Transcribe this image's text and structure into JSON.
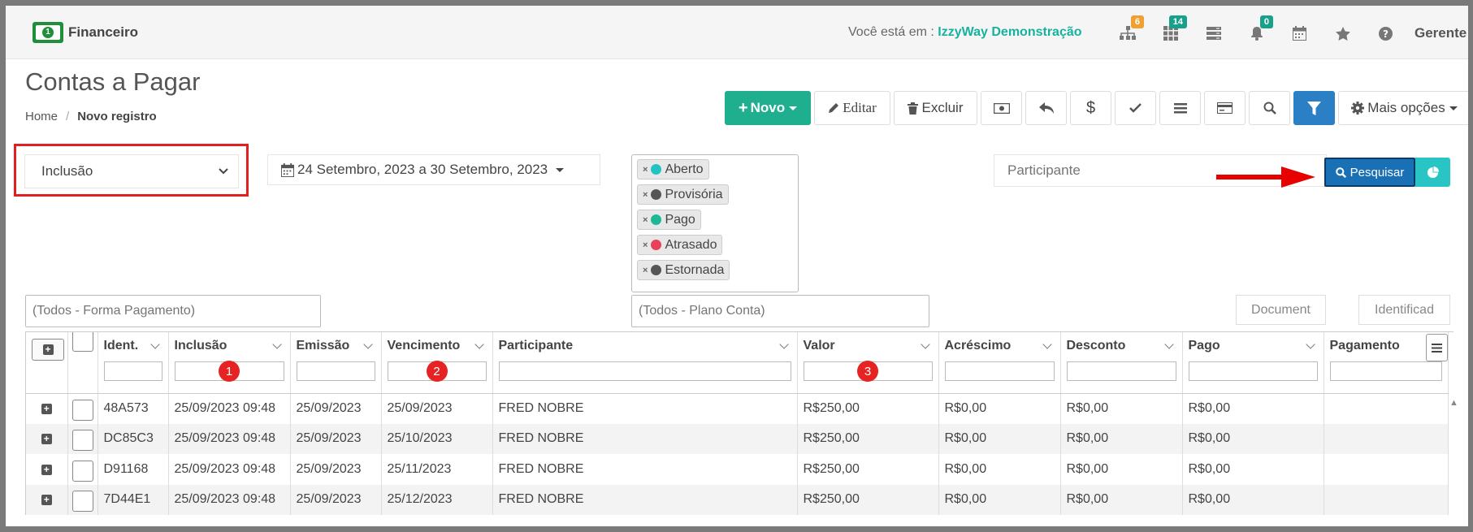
{
  "app": {
    "name": "Financeiro"
  },
  "topbar": {
    "location_prefix": "Você está em : ",
    "company": "IzzyWay Demonstração",
    "badges": {
      "sitemap": "6",
      "apps": "14",
      "notifications": "0"
    },
    "user": "Gerente"
  },
  "page": {
    "title": "Contas a Pagar",
    "breadcrumb": {
      "home": "Home",
      "current": "Novo registro"
    }
  },
  "toolbar": {
    "novo": "Novo",
    "editar": "Editar",
    "excluir": "Excluir",
    "mais_opcoes": "Mais opções"
  },
  "filters": {
    "date_type": "Inclusão",
    "date_range": "24 Setembro, 2023 a 30 Setembro, 2023",
    "statuses": [
      {
        "label": "Aberto",
        "color": "#23c3c3"
      },
      {
        "label": "Provisória",
        "color": "#555555"
      },
      {
        "label": "Pago",
        "color": "#1fb895"
      },
      {
        "label": "Atrasado",
        "color": "#e8425a"
      },
      {
        "label": "Estornada",
        "color": "#555555"
      }
    ],
    "participante_placeholder": "Participante",
    "pesquisar": "Pesquisar",
    "forma_pagamento": "(Todos - Forma Pagamento)",
    "plano_conta": "(Todos - Plano Conta)",
    "document": "Document",
    "identificad": "Identificad"
  },
  "markers": [
    "1",
    "2",
    "3"
  ],
  "table": {
    "columns": {
      "ident": "Ident.",
      "inclusao": "Inclusão",
      "emissao": "Emissão",
      "vencimento": "Vencimento",
      "participante": "Participante",
      "valor": "Valor",
      "acrescimo": "Acréscimo",
      "desconto": "Desconto",
      "pago": "Pago",
      "pagamento": "Pagamento"
    },
    "rows": [
      {
        "ident": "48A573",
        "inclusao": "25/09/2023 09:48",
        "emissao": "25/09/2023",
        "vencimento": "25/09/2023",
        "participante": "FRED NOBRE",
        "valor": "R$250,00",
        "acrescimo": "R$0,00",
        "desconto": "R$0,00",
        "pago": "R$0,00",
        "pagamento": ""
      },
      {
        "ident": "DC85C3",
        "inclusao": "25/09/2023 09:48",
        "emissao": "25/09/2023",
        "vencimento": "25/10/2023",
        "participante": "FRED NOBRE",
        "valor": "R$250,00",
        "acrescimo": "R$0,00",
        "desconto": "R$0,00",
        "pago": "R$0,00",
        "pagamento": ""
      },
      {
        "ident": "D91168",
        "inclusao": "25/09/2023 09:48",
        "emissao": "25/09/2023",
        "vencimento": "25/11/2023",
        "participante": "FRED NOBRE",
        "valor": "R$250,00",
        "acrescimo": "R$0,00",
        "desconto": "R$0,00",
        "pago": "R$0,00",
        "pagamento": ""
      },
      {
        "ident": "7D44E1",
        "inclusao": "25/09/2023 09:48",
        "emissao": "25/09/2023",
        "vencimento": "25/12/2023",
        "participante": "FRED NOBRE",
        "valor": "R$250,00",
        "acrescimo": "R$0,00",
        "desconto": "R$0,00",
        "pago": "R$0,00",
        "pagamento": ""
      }
    ]
  }
}
